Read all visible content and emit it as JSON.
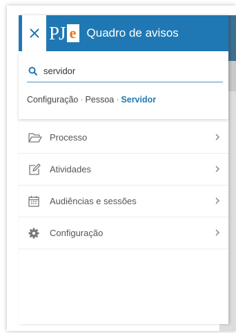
{
  "header": {
    "close_label": "×",
    "logo_text": "PJ",
    "logo_badge": "e",
    "title": "Quadro de avisos",
    "brand_color": "#1f78b4",
    "logo_accent": "#e6731f"
  },
  "search": {
    "value": "servidor",
    "icon": "search-icon",
    "breadcrumb": [
      "Configuração",
      "Pessoa",
      "Servidor"
    ]
  },
  "menu": {
    "items": [
      {
        "label": "Processo",
        "icon": "folder-open-icon"
      },
      {
        "label": "Atividades",
        "icon": "edit-icon"
      },
      {
        "label": "Audiências e sessões",
        "icon": "calendar-icon"
      },
      {
        "label": "Configuração",
        "icon": "gear-icon"
      }
    ]
  }
}
